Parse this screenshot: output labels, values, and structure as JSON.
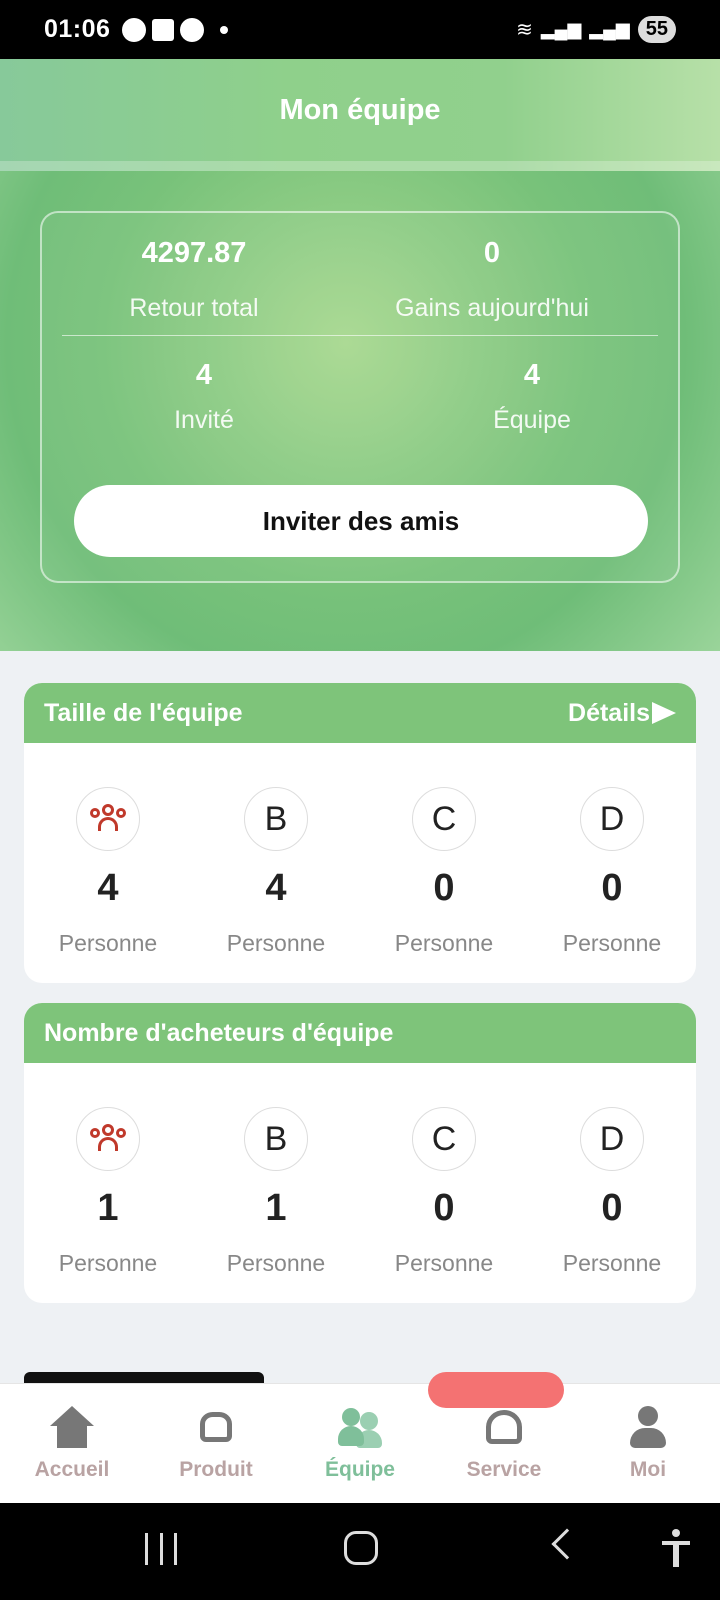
{
  "status_bar": {
    "time": "01:06",
    "battery": "55"
  },
  "header": {
    "title": "Mon équipe"
  },
  "stats": {
    "total_return_value": "4297.87",
    "total_return_label": "Retour total",
    "today_gains_value": "0",
    "today_gains_label": "Gains aujourd'hui",
    "invited_value": "4",
    "invited_label": "Invité",
    "team_value": "4",
    "team_label": "Équipe",
    "invite_button": "Inviter des amis"
  },
  "team_size": {
    "title": "Taille de l'équipe",
    "details_label": "Détails",
    "levels": [
      {
        "badge": "",
        "count": "4",
        "unit": "Personne"
      },
      {
        "badge": "B",
        "count": "4",
        "unit": "Personne"
      },
      {
        "badge": "C",
        "count": "0",
        "unit": "Personne"
      },
      {
        "badge": "D",
        "count": "0",
        "unit": "Personne"
      }
    ]
  },
  "buyers": {
    "title": "Nombre d'acheteurs d'équipe",
    "levels": [
      {
        "badge": "",
        "count": "1",
        "unit": "Personne"
      },
      {
        "badge": "B",
        "count": "1",
        "unit": "Personne"
      },
      {
        "badge": "C",
        "count": "0",
        "unit": "Personne"
      },
      {
        "badge": "D",
        "count": "0",
        "unit": "Personne"
      }
    ]
  },
  "bottom_nav": [
    {
      "label": "Accueil",
      "icon": "home-icon"
    },
    {
      "label": "Produit",
      "icon": "plant-icon"
    },
    {
      "label": "Équipe",
      "icon": "team-icon",
      "active": true
    },
    {
      "label": "Service",
      "icon": "support-icon"
    },
    {
      "label": "Moi",
      "icon": "user-icon"
    }
  ],
  "colors": {
    "accent": "#7ec47a",
    "active_nav": "#7fbf9a",
    "level_icon": "#c0392b",
    "pill": "#f47272"
  }
}
